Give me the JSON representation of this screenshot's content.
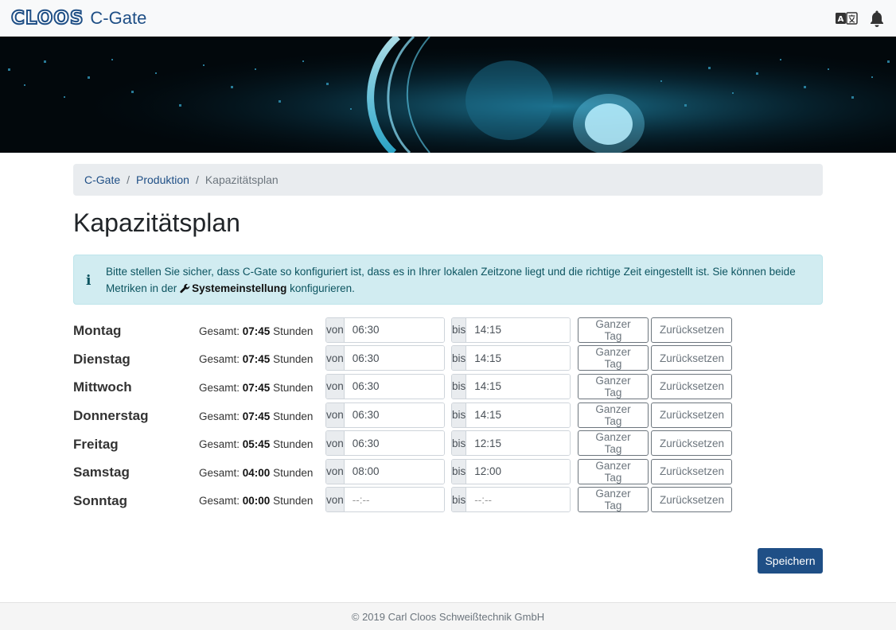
{
  "navbar": {
    "logo": "CLOOS",
    "app_name": "C-Gate",
    "icons": [
      "translate-icon",
      "bell-icon"
    ]
  },
  "breadcrumb": {
    "items": [
      "C-Gate",
      "Produktion"
    ],
    "active": "Kapazitätsplan"
  },
  "page": {
    "title": "Kapazitätsplan"
  },
  "alert": {
    "text_before": "Bitte stellen Sie sicher, dass C-Gate so konfiguriert ist, dass es in Ihrer lokalen Zeitzone liegt und die richtige Zeit eingestellt ist. Sie können beide Metriken in der",
    "link": "Systemeinstellung",
    "text_after": "konfigurieren."
  },
  "schedule": {
    "total_prefix": "Gesamt:",
    "total_suffix": "Stunden",
    "from_label": "von",
    "to_label": "bis",
    "placeholder": "--:--",
    "full_day_label": "Ganzer Tag",
    "reset_label": "Zurücksetzen",
    "days": [
      {
        "name": "Montag",
        "total": "07:45",
        "from": "06:30",
        "to": "14:15"
      },
      {
        "name": "Dienstag",
        "total": "07:45",
        "from": "06:30",
        "to": "14:15"
      },
      {
        "name": "Mittwoch",
        "total": "07:45",
        "from": "06:30",
        "to": "14:15"
      },
      {
        "name": "Donnerstag",
        "total": "07:45",
        "from": "06:30",
        "to": "14:15"
      },
      {
        "name": "Freitag",
        "total": "05:45",
        "from": "06:30",
        "to": "12:15"
      },
      {
        "name": "Samstag",
        "total": "04:00",
        "from": "08:00",
        "to": "12:00"
      },
      {
        "name": "Sonntag",
        "total": "00:00",
        "from": "",
        "to": ""
      }
    ]
  },
  "save_label": "Speichern",
  "footer": {
    "text": "© 2019 Carl Cloos Schweißtechnik GmbH"
  },
  "colors": {
    "brand": "#1f4f86",
    "alert_bg": "#d1ecf1",
    "alert_text": "#0c5460"
  }
}
